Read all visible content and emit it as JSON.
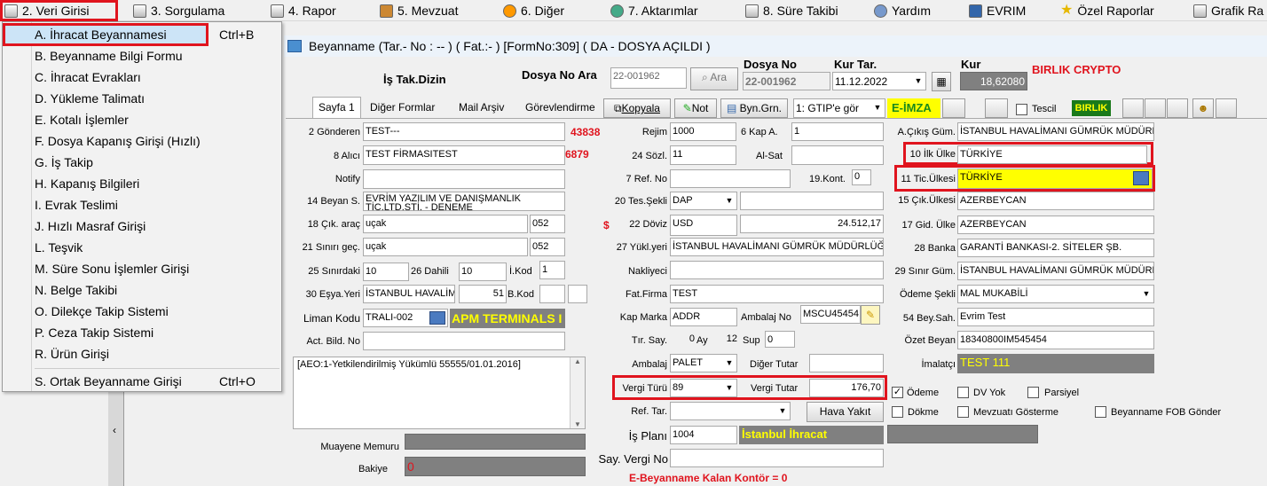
{
  "menubar": {
    "items": [
      {
        "label": "2.  Veri Girisi"
      },
      {
        "label": "3.  Sorgulama"
      },
      {
        "label": "4.  Rapor"
      },
      {
        "label": "5.  Mevzuat"
      },
      {
        "label": "6.  Diğer"
      },
      {
        "label": "7.  Aktarımlar"
      },
      {
        "label": "8. Süre Takibi"
      },
      {
        "label": "Yardım"
      },
      {
        "label": "EVRIM"
      },
      {
        "label": "Özel Raporlar"
      },
      {
        "label": "Grafik Ra"
      }
    ]
  },
  "dropdown": {
    "items": [
      {
        "label": "A.  İhracat Beyannamesi",
        "shortcut": "Ctrl+B"
      },
      {
        "label": "B.  Beyanname Bilgi Formu"
      },
      {
        "label": "C.  İhracat Evrakları"
      },
      {
        "label": "D.  Yükleme Talimatı"
      },
      {
        "label": "E.  Kotalı İşlemler"
      },
      {
        "label": "F.  Dosya Kapanış Girişi (Hızlı)"
      },
      {
        "label": "G.  İş Takip"
      },
      {
        "label": "H.  Kapanış Bilgileri"
      },
      {
        "label": "I.  Evrak Teslimi"
      },
      {
        "label": "J.  Hızlı Masraf Girişi"
      },
      {
        "label": "L.  Teşvik"
      },
      {
        "label": "M.  Süre Sonu İşlemler Girişi"
      },
      {
        "label": "N.  Belge Takibi"
      },
      {
        "label": "O.  Dilekçe Takip Sistemi"
      },
      {
        "label": "P.  Ceza Takip Sistemi"
      },
      {
        "label": "R.  Ürün Girişi"
      },
      {
        "label": "S.  Ortak Beyanname Girişi",
        "shortcut": "Ctrl+O"
      }
    ]
  },
  "form": {
    "title": "Beyanname (Tar.- No :  -- ) ( Fat.:- )  [FormNo:309] ( DA - DOSYA AÇILDI )",
    "is_tak_dizin": "İş Tak.Dizin",
    "dosya_no_ara_label": "Dosya No Ara",
    "dosya_no_ara_value": "22-001962",
    "ara_button": "Ara",
    "dosya_no_label": "Dosya No",
    "dosya_no_value": "22-001962",
    "kur_tar_label": "Kur Tar.",
    "kur_tar_value": "11.12.2022",
    "kur_label": "Kur",
    "kur_value": "18,62080",
    "company": "BIRLIK CRYPTO",
    "tabs": [
      "Sayfa 1",
      "Diğer Formlar",
      "Mail Arşiv",
      "Görevlendirme"
    ],
    "kopyala": "Kopyala",
    "not": "Not",
    "byn_grn": "Byn.Grn.",
    "gtip_select": "1: GTIP'e gör",
    "e_imza": "E-İMZA",
    "tescil": "Tescil",
    "birlik": "BIRLIK",
    "left": {
      "gonderen_label": "2 Gönderen",
      "gonderen": "TEST---",
      "gonderen_code": "43838",
      "alici_label": "8 Alıcı",
      "alici": "TEST FİRMASITEST",
      "alici_code": "6879",
      "notify_label": "Notify",
      "beyan_label": "14 Beyan S.",
      "beyan": "EVRİM YAZILIM VE DANIŞMANLIK",
      "beyan2": "TİC.LTD.ŞTİ. - DENEME",
      "cik_arac_label": "18 Çık. araç",
      "cik_arac": "uçak",
      "cik_arac_code": "052",
      "sinir_gec_label": "21 Sınırı geç.",
      "sinir_gec": "uçak",
      "sinir_gec_code": "052",
      "sinirdaki_label": "25 Sınırdaki",
      "sinirdaki": "10",
      "dahili_label": "26 Dahili",
      "dahili": "10",
      "ikod_label": "İ.Kod",
      "ikod": "1",
      "esya_yeri_label": "30 Eşya.Yeri",
      "esya_yeri": "İSTANBUL HAVALİM",
      "esya_num": "51",
      "bkod_label": "B.Kod",
      "liman_label": "Liman Kodu",
      "liman": "TRALI-002",
      "liman_name": "APM TERMINALS I",
      "act_bild_label": "Act. Bild. No",
      "aeo_text": "[AEO:1-Yetkilendirilmiş Yükümlü 55555/01.01.2016]",
      "muayene_label": "Muayene Memuru",
      "bakiye_label": "Bakiye",
      "bakiye": "0"
    },
    "mid": {
      "rejim_label": "Rejim",
      "rejim": "1000",
      "kap_a_label": "6 Kap A.",
      "kap_a": "1",
      "sozl_label": "24 Sözl.",
      "sozl": "11",
      "al_sat_label": "Al-Sat",
      "ref_no_label": "7 Ref. No",
      "kont_label": "19.Kont.",
      "kont": "0",
      "tes_sekli_label": "20 Tes.Şekli",
      "tes_sekli": "DAP",
      "doviz_label": "22 Döviz",
      "doviz": "USD",
      "doviz_amount": "24.512,17",
      "dollar": "$",
      "yukl_yeri_label": "27 Yükl.yeri",
      "yukl_yeri": "İSTANBUL HAVALİMANI GÜMRÜK MÜDÜRLÜĞ",
      "nakliyeci_label": "Nakliyeci",
      "fat_firma_label": "Fat.Firma",
      "fat_firma": "TEST",
      "kap_marka_label": "Kap Marka",
      "kap_marka": "ADDR",
      "ambalaj_no_label": "Ambalaj No",
      "ambalaj_no": "MSCU45454!",
      "tir_say_label": "Tır. Say.",
      "tir_say": "0",
      "ay_label": "Ay",
      "ay": "12",
      "sup_label": "Sup",
      "sup": "0",
      "ambalaj_label": "Ambalaj",
      "ambalaj": "PALET",
      "diger_tutar_label": "Diğer Tutar",
      "vergi_turu_label": "Vergi Türü",
      "vergi_turu": "89",
      "vergi_tutar_label": "Vergi Tutar",
      "vergi_tutar": "176,70",
      "ref_tar_label": "Ref. Tar.",
      "hava_yakit": "Hava Yakıt",
      "is_plani_label": "İş Planı",
      "is_plani": "1004",
      "is_plani_name": "İstanbul İhracat",
      "say_vergi_label": "Say. Vergi No",
      "kalan_kontor": "E-Beyanname Kalan Kontör = 0"
    },
    "right": {
      "a_cikis_label": "A.Çıkış Güm.",
      "a_cikis": "İSTANBUL HAVALİMANI GÜMRÜK MÜDÜRL",
      "ilk_ulke_label": "10 İlk Ülke",
      "ilk_ulke": "TÜRKİYE",
      "tic_ulkesi_label": "11 Tic.Ülkesi",
      "tic_ulkesi": "TÜRKİYE",
      "cik_ulkesi_label": "15 Çık.Ülkesi",
      "cik_ulkesi": "AZERBEYCAN",
      "gid_ulke_label": "17 Gid. Ülke",
      "gid_ulke": "AZERBEYCAN",
      "banka_label": "28 Banka",
      "banka": "GARANTİ BANKASI-2. SİTELER ŞB.",
      "sinir_gum_label": "29 Sınır Güm.",
      "sinir_gum": "İSTANBUL HAVALİMANI GÜMRÜK MÜDÜRL",
      "odeme_sekli_label": "Ödeme Şekli",
      "odeme_sekli": "MAL MUKABİLİ",
      "bey_sah_label": "54 Bey.Sah.",
      "bey_sah": "Evrim Test",
      "ozet_beyan_label": "Özet Beyan",
      "ozet_beyan": "18340800IM545454",
      "imalatci_label": "İmalatçı",
      "imalatci": "TEST 111",
      "odeme": "Ödeme",
      "dv_yok": "DV Yok",
      "parsiyel": "Parsiyel",
      "dokme": "Dökme",
      "mevzuati": "Mevzuatı Gösterme",
      "fob_gonder": "Beyanname FOB Gönder"
    }
  }
}
